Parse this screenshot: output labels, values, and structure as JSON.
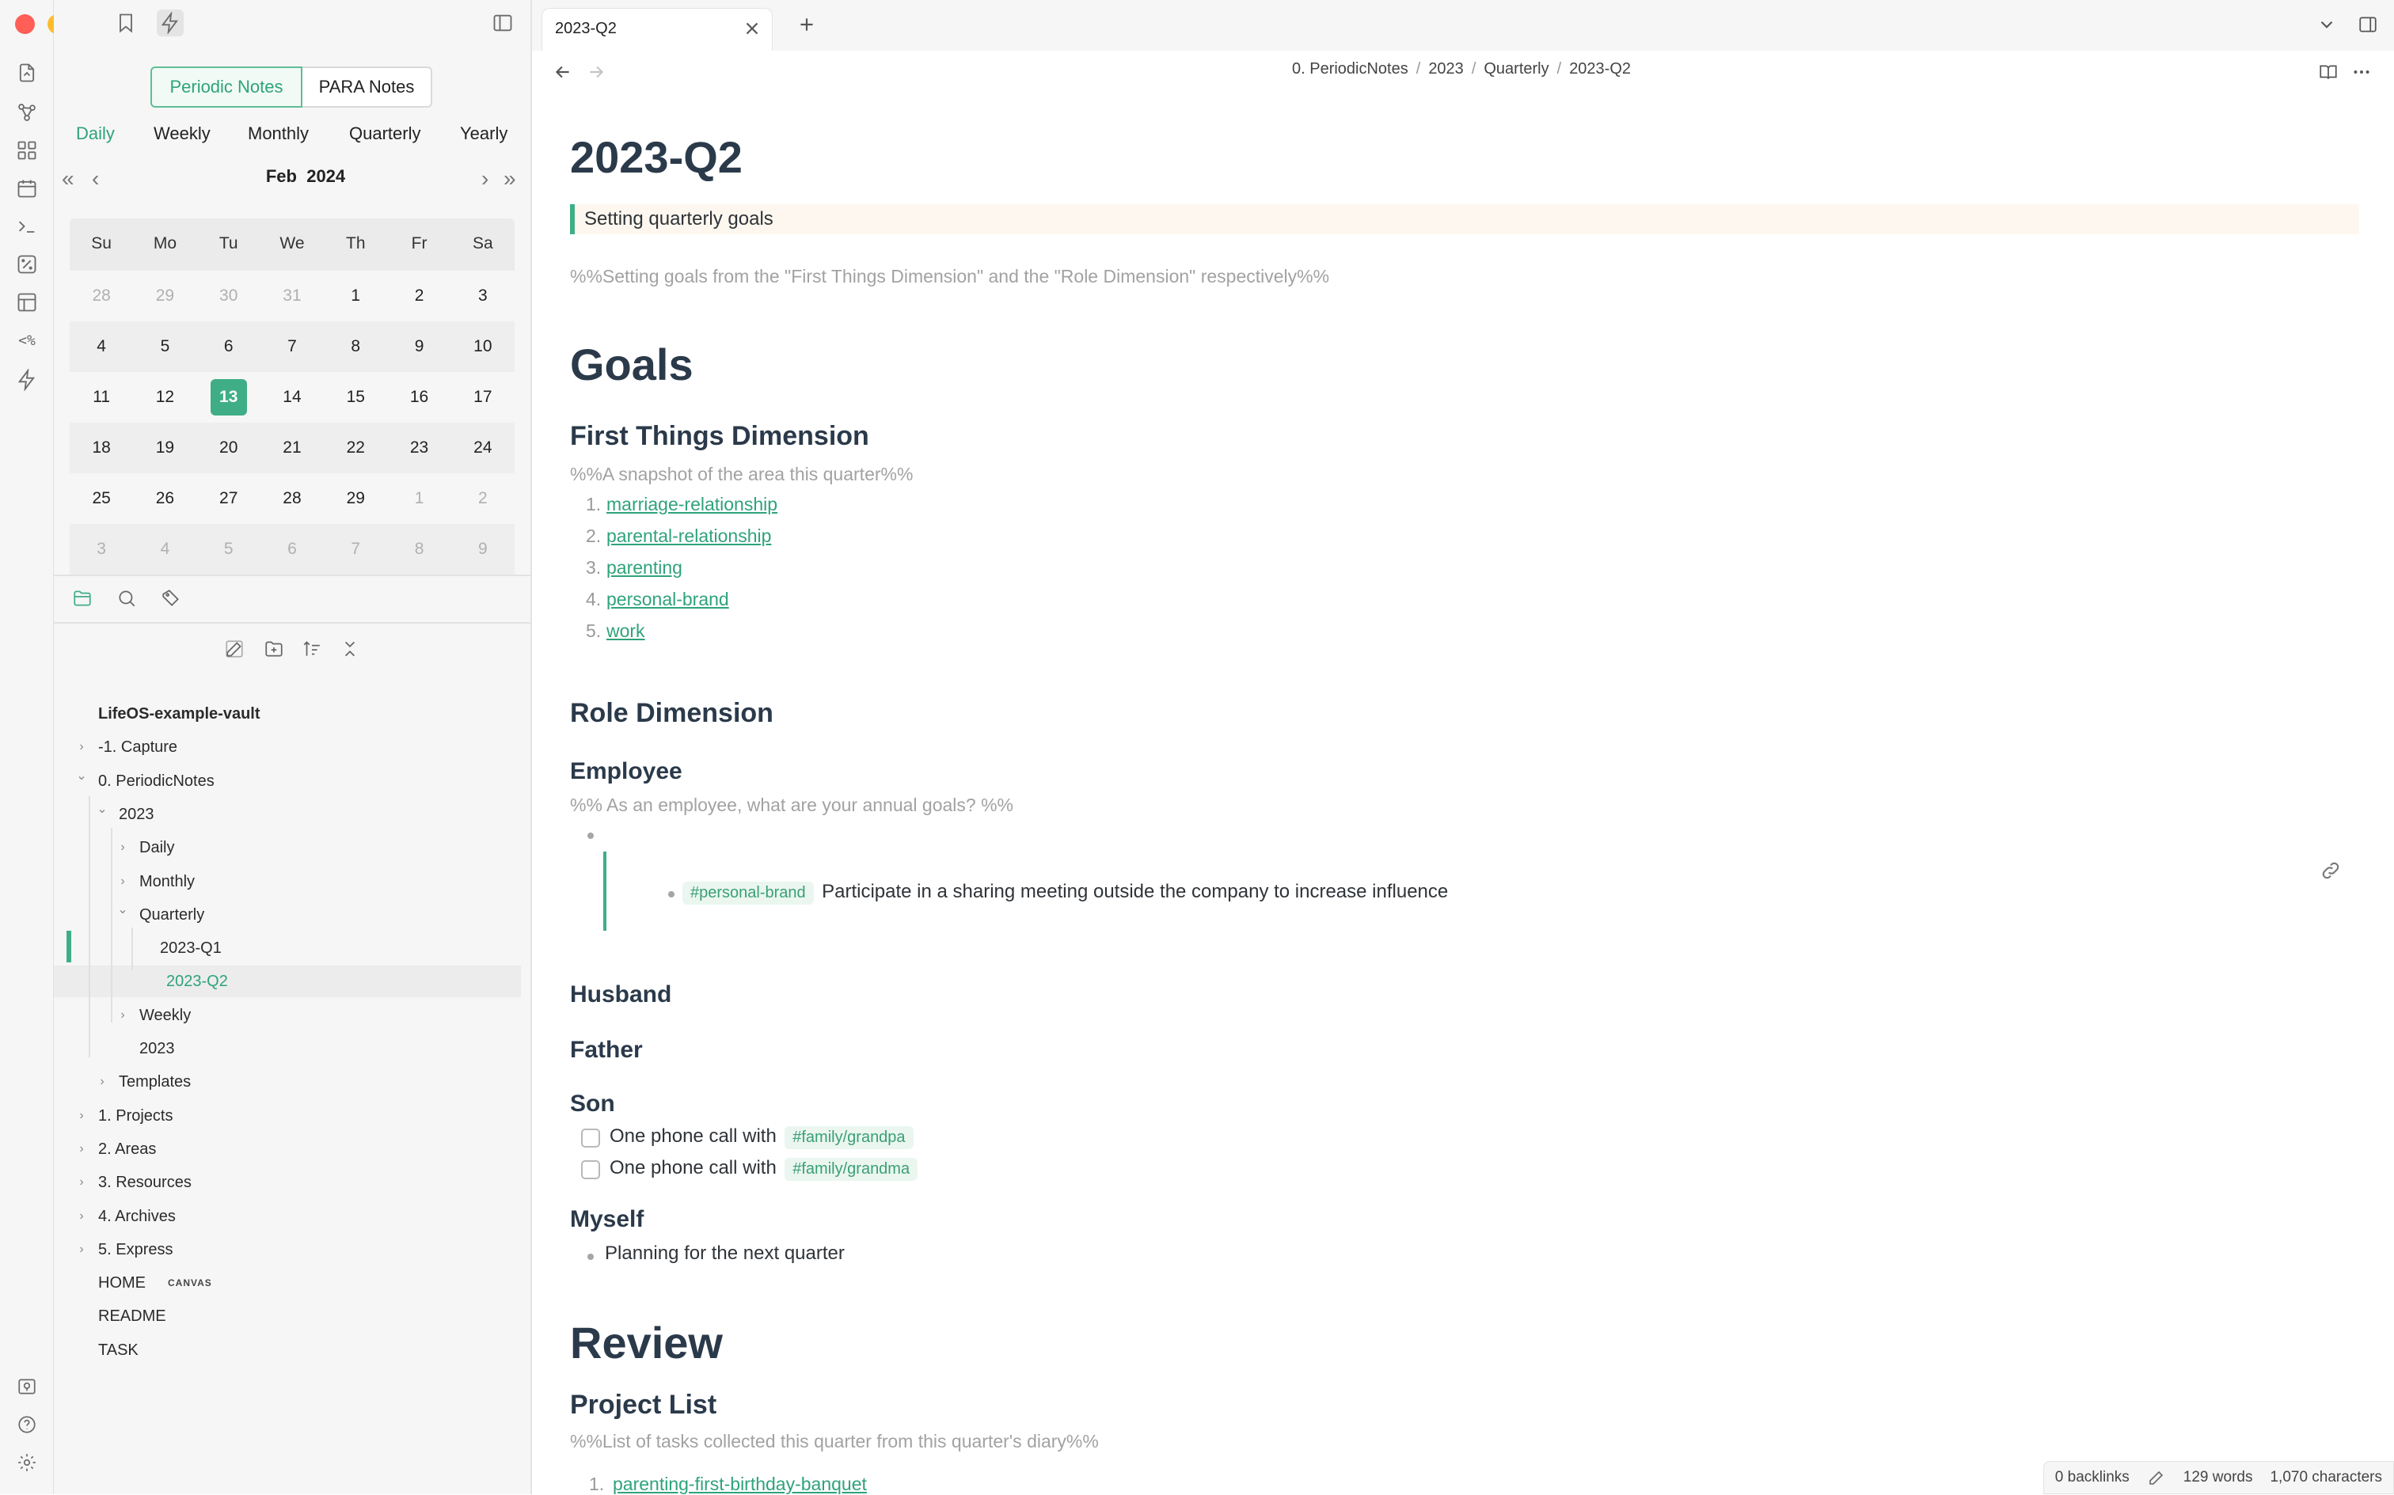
{
  "window": {
    "traffic": {
      "close": "#ff5f57",
      "minimize": "#febc2e",
      "maximize": "#28c840"
    }
  },
  "colors": {
    "accent": "#3fae86",
    "link": "#2fa37a",
    "heading": "#2b3a4a",
    "comment": "#a2a2a2"
  },
  "ribbon": {
    "icons": [
      "open-file-icon",
      "graph-icon",
      "dashboard-icon",
      "calendar-icon",
      "terminal-icon",
      "random-icon",
      "template-icon",
      "templater-icon",
      "command-icon"
    ]
  },
  "sidebar": {
    "plugin_tabs": [
      "Periodic Notes",
      "PARA Notes"
    ],
    "period_tabs": [
      "Daily",
      "Weekly",
      "Monthly",
      "Quarterly",
      "Yearly"
    ],
    "calendar": {
      "month": "Feb",
      "year": "2024",
      "weekdays": [
        "Su",
        "Mo",
        "Tu",
        "We",
        "Th",
        "Fr",
        "Sa"
      ],
      "today": "13",
      "weeks": [
        [
          {
            "d": "28",
            "o": true
          },
          {
            "d": "29",
            "o": true
          },
          {
            "d": "30",
            "o": true
          },
          {
            "d": "31",
            "o": true
          },
          {
            "d": "1"
          },
          {
            "d": "2"
          },
          {
            "d": "3"
          }
        ],
        [
          {
            "d": "4"
          },
          {
            "d": "5"
          },
          {
            "d": "6"
          },
          {
            "d": "7"
          },
          {
            "d": "8"
          },
          {
            "d": "9"
          },
          {
            "d": "10"
          }
        ],
        [
          {
            "d": "11"
          },
          {
            "d": "12"
          },
          {
            "d": "13",
            "today": true
          },
          {
            "d": "14"
          },
          {
            "d": "15"
          },
          {
            "d": "16"
          },
          {
            "d": "17"
          }
        ],
        [
          {
            "d": "18"
          },
          {
            "d": "19"
          },
          {
            "d": "20"
          },
          {
            "d": "21"
          },
          {
            "d": "22"
          },
          {
            "d": "23"
          },
          {
            "d": "24"
          }
        ],
        [
          {
            "d": "25"
          },
          {
            "d": "26"
          },
          {
            "d": "27"
          },
          {
            "d": "28"
          },
          {
            "d": "29"
          },
          {
            "d": "1",
            "o": true
          },
          {
            "d": "2",
            "o": true
          }
        ],
        [
          {
            "d": "3",
            "o": true
          },
          {
            "d": "4",
            "o": true
          },
          {
            "d": "5",
            "o": true
          },
          {
            "d": "6",
            "o": true
          },
          {
            "d": "7",
            "o": true
          },
          {
            "d": "8",
            "o": true
          },
          {
            "d": "9",
            "o": true
          }
        ]
      ]
    },
    "tree": [
      {
        "label": "LifeOS-example-vault",
        "depth": 0,
        "type": "vault"
      },
      {
        "label": "-1. Capture",
        "depth": 0,
        "type": "folder",
        "open": false
      },
      {
        "label": "0. PeriodicNotes",
        "depth": 0,
        "type": "folder",
        "open": true
      },
      {
        "label": "2023",
        "depth": 1,
        "type": "folder",
        "open": true
      },
      {
        "label": "Daily",
        "depth": 2,
        "type": "folder",
        "open": false
      },
      {
        "label": "Monthly",
        "depth": 2,
        "type": "folder",
        "open": false
      },
      {
        "label": "Quarterly",
        "depth": 2,
        "type": "folder",
        "open": true
      },
      {
        "label": "2023-Q1",
        "depth": 3,
        "type": "file"
      },
      {
        "label": "2023-Q2",
        "depth": 3,
        "type": "file",
        "selected": true
      },
      {
        "label": "Weekly",
        "depth": 2,
        "type": "folder",
        "open": false
      },
      {
        "label": "2023",
        "depth": 2,
        "type": "file"
      },
      {
        "label": "Templates",
        "depth": 1,
        "type": "folder",
        "open": false
      },
      {
        "label": "1. Projects",
        "depth": 0,
        "type": "folder",
        "open": false
      },
      {
        "label": "2. Areas",
        "depth": 0,
        "type": "folder",
        "open": false
      },
      {
        "label": "3. Resources",
        "depth": 0,
        "type": "folder",
        "open": false
      },
      {
        "label": "4. Archives",
        "depth": 0,
        "type": "folder",
        "open": false
      },
      {
        "label": "5. Express",
        "depth": 0,
        "type": "folder",
        "open": false
      },
      {
        "label": "HOME",
        "depth": 0,
        "type": "file",
        "badge": "CANVAS"
      },
      {
        "label": "README",
        "depth": 0,
        "type": "file"
      },
      {
        "label": "TASK",
        "depth": 0,
        "type": "file"
      }
    ]
  },
  "tabs": [
    {
      "label": "2023-Q2"
    }
  ],
  "breadcrumb": [
    "0. PeriodicNotes",
    "2023",
    "Quarterly",
    "2023-Q2"
  ],
  "note": {
    "title": "2023-Q2",
    "callout": "Setting quarterly goals",
    "intro_comment": "%%Setting goals from the \"First Things Dimension\" and the \"Role Dimension\" respectively%%",
    "goals_heading": "Goals",
    "first_things": {
      "heading": "First Things Dimension",
      "comment": "%%A snapshot of the area this quarter%%",
      "items": [
        "marriage-relationship",
        "parental-relationship",
        "parenting",
        "personal-brand",
        "work"
      ]
    },
    "role": {
      "heading": "Role Dimension",
      "employee_heading": "Employee",
      "employee_comment": "%% As an employee, what are your annual goals? %%",
      "employee_tag": "#personal-brand",
      "employee_task": "Participate in a sharing meeting outside the company to increase influence",
      "husband_heading": "Husband",
      "father_heading": "Father",
      "son_heading": "Son",
      "son_tasks": [
        {
          "text": "One phone call with",
          "tag": "#family/grandpa"
        },
        {
          "text": "One phone call with",
          "tag": "#family/grandma"
        }
      ],
      "myself_heading": "Myself",
      "myself_item": "Planning for the next quarter"
    },
    "review_heading": "Review",
    "project_list_heading": "Project List",
    "project_list_comment": "%%List of tasks collected this quarter from this quarter's diary%%",
    "project_first": "parenting-first-birthday-banquet"
  },
  "status": {
    "backlinks": "0 backlinks",
    "words": "129 words",
    "characters": "1,070 characters"
  }
}
